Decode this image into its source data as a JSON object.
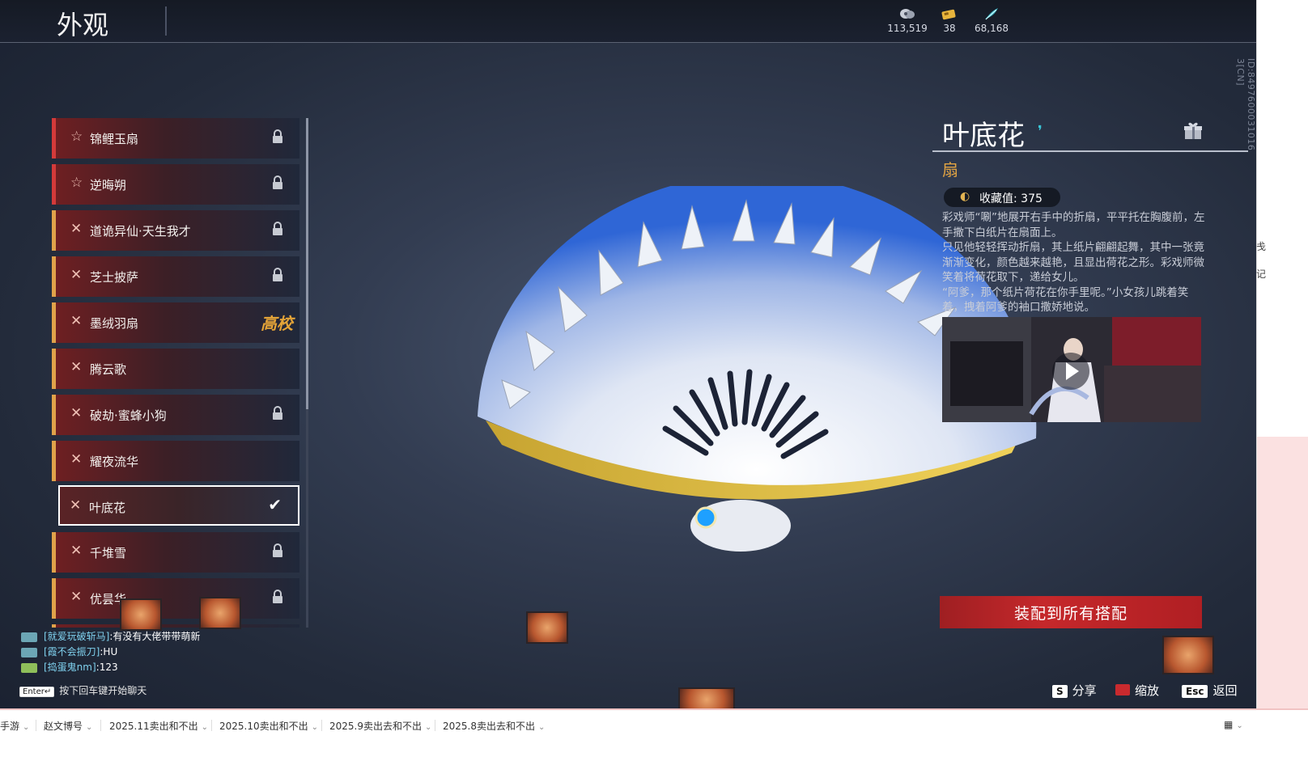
{
  "header": {
    "title": "外观",
    "currencies": [
      {
        "icon": "coin-stack-icon",
        "value": "113,519"
      },
      {
        "icon": "ticket-icon",
        "value": "38"
      },
      {
        "icon": "feather-icon",
        "value": "68,168"
      }
    ]
  },
  "side_id": "ID:8497600031016 3[CN]",
  "list": {
    "items": [
      {
        "label": "锦鲤玉扇",
        "icon": "star-icon",
        "rarity": "red",
        "state": "locked"
      },
      {
        "label": "逆晦朔",
        "icon": "star-icon",
        "rarity": "red",
        "state": "locked"
      },
      {
        "label": "道诡异仙·天生我才",
        "icon": "cross-icon",
        "rarity": "gold",
        "state": "locked"
      },
      {
        "label": "芝士披萨",
        "icon": "cross-icon",
        "rarity": "gold",
        "state": "locked"
      },
      {
        "label": "墨绒羽扇",
        "icon": "cross-icon",
        "rarity": "gold",
        "state": "badge",
        "badge": "高校"
      },
      {
        "label": "腾云歌",
        "icon": "cross-icon",
        "rarity": "gold",
        "state": "none"
      },
      {
        "label": "破劫·蜜蜂小狗",
        "icon": "cross-icon",
        "rarity": "gold",
        "state": "locked"
      },
      {
        "label": "耀夜流华",
        "icon": "cross-icon",
        "rarity": "gold",
        "state": "none"
      },
      {
        "label": "叶底花",
        "icon": "cross-icon",
        "rarity": "gold",
        "state": "selected"
      },
      {
        "label": "千堆雪",
        "icon": "cross-icon",
        "rarity": "gold",
        "state": "locked"
      },
      {
        "label": "优昙华",
        "icon": "cross-icon",
        "rarity": "gold",
        "state": "locked"
      }
    ]
  },
  "detail": {
    "name": "叶底花",
    "type": "扇",
    "collect_label": "收藏值: 375",
    "description": [
      "彩戏师“唰”地展开右手中的折扇，平平托在胸腹前，左手撒下白纸片在扇面上。",
      "只见他轻轻挥动折扇，其上纸片翩翩起舞，其中一张竟渐渐变化，颜色越来越艳，且显出荷花之形。彩戏师微笑着将荷花取下，递给女儿。",
      "“阿爹，那个纸片荷花在你手里呢。”小女孩儿跳着笑着，拽着阿爹的袖口撒娇地说。"
    ],
    "equip_button": "装配到所有搭配"
  },
  "chat": {
    "messages": [
      {
        "name": "[就爱玩破斩马]",
        "text": ":有没有大佬带带萌新"
      },
      {
        "name": "[霞不会振刀]",
        "text": ":HU"
      },
      {
        "name": "[捣蛋鬼nm]",
        "text": ":123"
      }
    ],
    "enter_key": "Enter↵",
    "enter_hint": "按下回车键开始聊天"
  },
  "hints": {
    "share_key": "S",
    "share": "分享",
    "zoom": "缩放",
    "back_key": "Esc",
    "back": "返回"
  },
  "taskbar": {
    "tabs": [
      "手游",
      "赵文博号",
      "2025.11卖出和不出",
      "2025.10卖出和不出",
      "2025.9卖出去和不出",
      "2025.8卖出去和不出"
    ]
  },
  "right_strip": {
    "t1": "戋",
    "t2": "记"
  }
}
